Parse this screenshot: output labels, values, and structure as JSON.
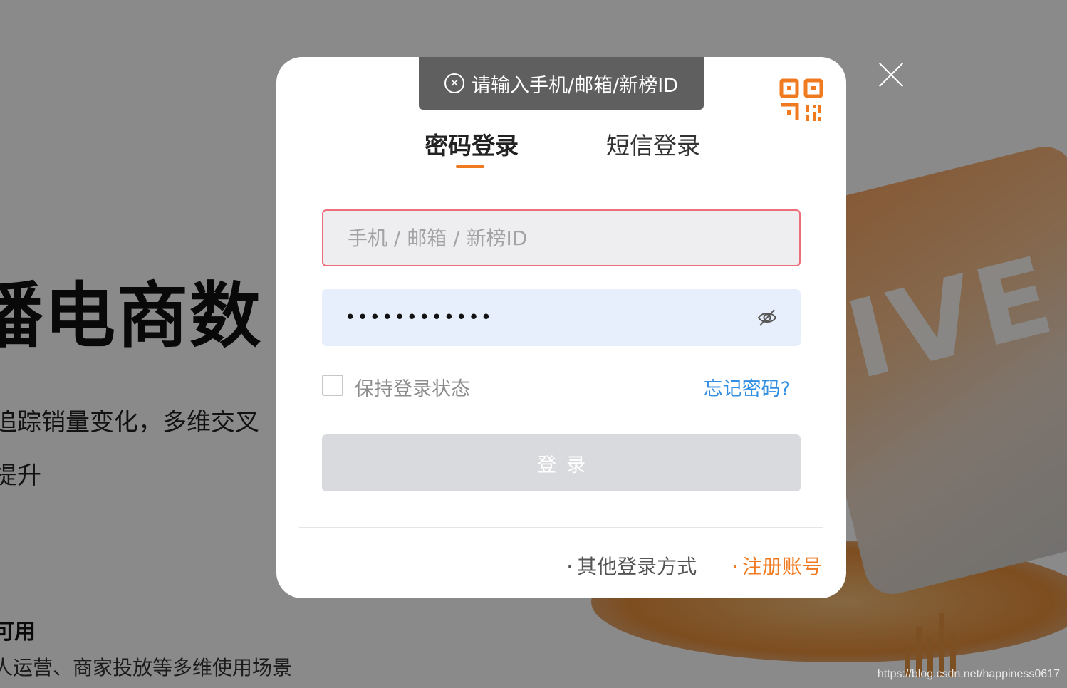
{
  "background": {
    "title": "播电商数",
    "description_line1": "追踪销量变化，多维交叉",
    "description_line2": "提升",
    "feature_title": "可用",
    "feature_desc": "人运营、商家投放等多维使用场景",
    "art_text": "IVE",
    "watermark": "https://blog.csdn.net/happiness0617"
  },
  "toast": {
    "icon": "circle-x-icon",
    "message": "请输入手机/邮箱/新榜ID"
  },
  "modal": {
    "qr_icon": "qr-code-icon",
    "tabs": [
      {
        "label": "密码登录",
        "active": true
      },
      {
        "label": "短信登录",
        "active": false
      }
    ],
    "account_field": {
      "placeholder": "手机 / 邮箱 / 新榜ID",
      "value": ""
    },
    "password_field": {
      "masked_value": "••••••••••••",
      "toggle_icon": "eye-off-icon"
    },
    "remember_label": "保持登录状态",
    "remember_checked": false,
    "forgot_label": "忘记密码?",
    "login_button": "登录",
    "footer": {
      "other_login": "其他登录方式",
      "register": "注册账号",
      "bullet": "·"
    }
  },
  "colors": {
    "accent": "#f07a20",
    "link": "#2f8ee2",
    "error_border": "#ee6d7a",
    "toast_bg": "#5f5f5f"
  }
}
